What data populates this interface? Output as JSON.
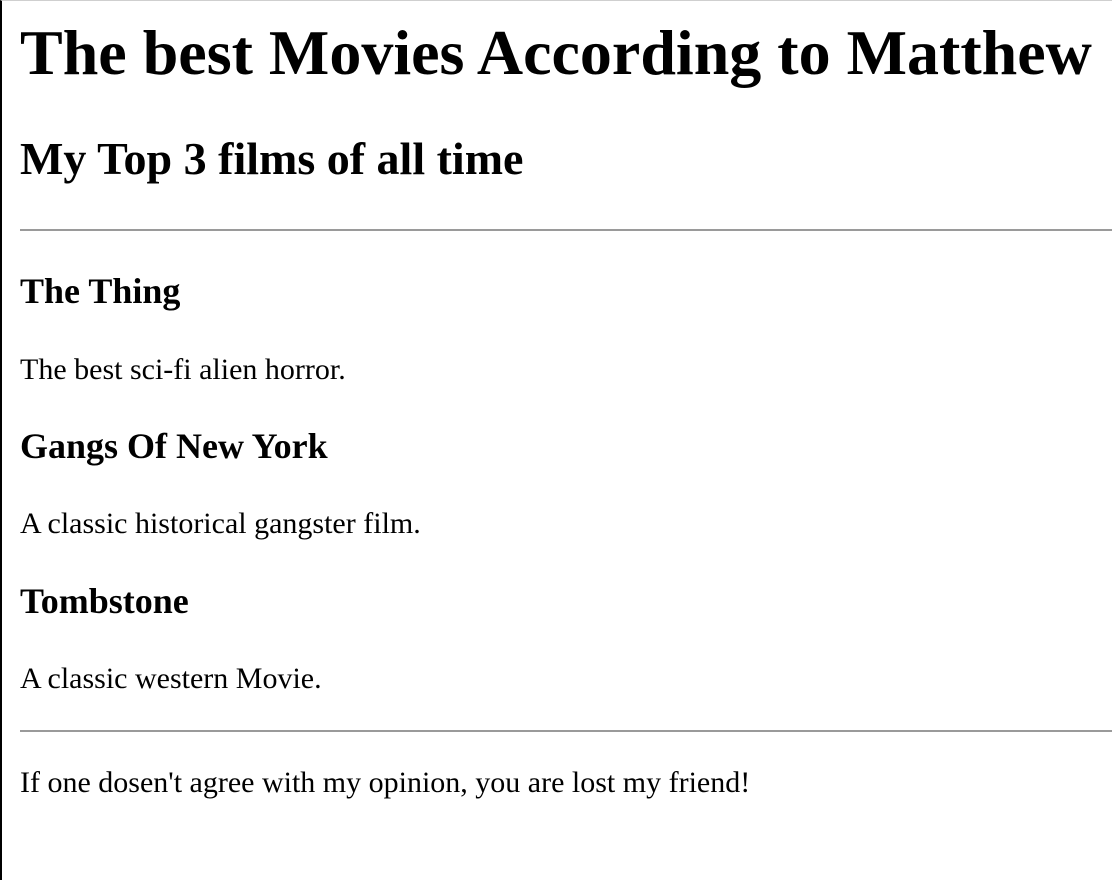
{
  "header": {
    "title": "The best Movies According to Matthew",
    "subtitle": "My Top 3 films of all time"
  },
  "movies": [
    {
      "title": "The Thing",
      "description": "The best sci-fi alien horror."
    },
    {
      "title": "Gangs Of New York",
      "description": "A classic historical gangster film."
    },
    {
      "title": "Tombstone",
      "description": "A classic western Movie."
    }
  ],
  "footer": {
    "text": "If one dosen't agree with my opinion, you are lost my friend!"
  }
}
